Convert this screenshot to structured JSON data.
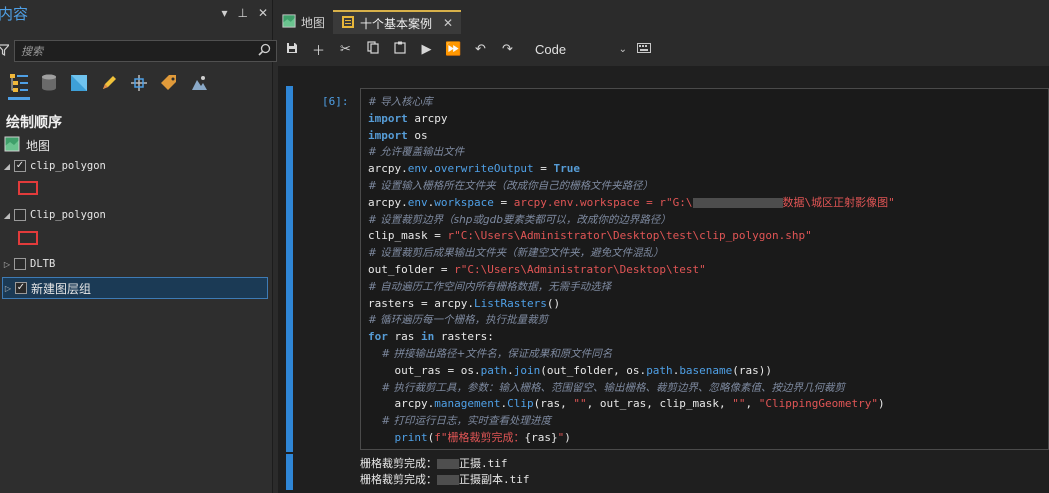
{
  "pane": {
    "title": "内容",
    "controls": [
      "▾",
      "⊥",
      "✕"
    ],
    "search_placeholder": "搜索",
    "section_title": "绘制顺序",
    "map_label": "地图",
    "layers": [
      {
        "name": "clip_polygon",
        "checked": true,
        "expanded": true,
        "swatch": "#e23b3b"
      },
      {
        "name": "Clip_polygon",
        "checked": false,
        "expanded": true,
        "swatch": "#e23b3b"
      },
      {
        "name": "DLTB",
        "checked": false,
        "expanded": false
      },
      {
        "name": "新建图层组",
        "checked": true,
        "expanded": false,
        "selected": true
      }
    ]
  },
  "tabs": [
    {
      "label": "地图",
      "active": false
    },
    {
      "label": "十个基本案例",
      "active": true
    }
  ],
  "toolbar": {
    "cell_type": "Code"
  },
  "cell": {
    "prompt": "[6]:",
    "lines": [
      "# 导入核心库",
      "import arcpy",
      "import os",
      "# 允许覆盖输出文件",
      "arcpy.env.overwriteOutput = True",
      "# 设置输入栅格所在文件夹（改成你自己的栅格文件夹路径）",
      "arcpy.env.workspace = r\"G:\\",
      "数据\\城区正射影像图\"",
      "# 设置裁剪边界（shp或gdb要素类都可以，改成你的边界路径）",
      "clip_mask = r\"C:\\Users\\Administrator\\Desktop\\test\\clip_polygon.shp\"",
      "# 设置裁剪后成果输出文件夹（新建空文件夹，避免文件混乱）",
      "out_folder = r\"C:\\Users\\Administrator\\Desktop\\test\"",
      "# 自动遍历工作空间内所有栅格数据，无需手动选择",
      "rasters = arcpy.ListRasters()",
      "# 循环遍历每一个栅格，执行批量裁剪",
      "for ras in rasters:",
      "    # 拼接输出路径+文件名，保证成果和原文件同名",
      "    out_ras = os.path.join(out_folder, os.path.basename(ras))",
      "    # 执行裁剪工具，参数：输入栅格、范围留空、输出栅格、裁剪边界、忽略像素值、按边界几何裁剪",
      "    arcpy.management.Clip(ras, \"\", out_ras, clip_mask, \"\", \"ClippingGeometry\")",
      "    # 打印运行日志，实时查看处理进度",
      "    print(f\"栅格裁剪完成：{ras}\")"
    ]
  },
  "output": {
    "prefix": "栅格裁剪完成：",
    "lines": [
      "正摄.tif",
      "正摄副本.tif"
    ]
  },
  "colors": {
    "accent": "#2f86d6",
    "comment": "#7e8aa0",
    "keyword": "#569cd6",
    "string": "#e05555",
    "swatch": "#e23b3b"
  }
}
